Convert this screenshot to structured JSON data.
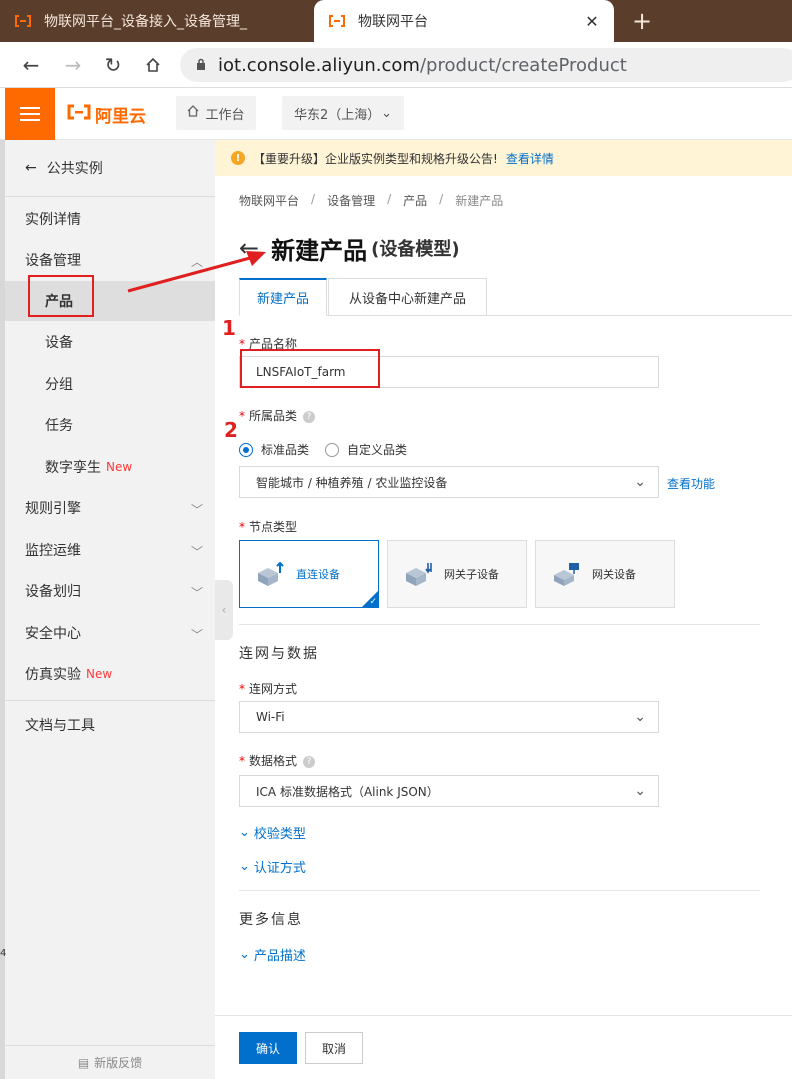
{
  "browser": {
    "tabs": [
      {
        "title": "物联网平台_设备接入_设备管理_",
        "active": false
      },
      {
        "title": "物联网平台",
        "active": true
      }
    ],
    "url_host": "iot.console.aliyun.com",
    "url_path": "/product/createProduct"
  },
  "header": {
    "logo_text": "阿里云",
    "workbench_label": "工作台",
    "region_label": "华东2（上海）"
  },
  "sidebar": {
    "back_label": "公共实例",
    "items": [
      {
        "label": "实例详情"
      },
      {
        "label": "设备管理"
      },
      {
        "label": "产品"
      },
      {
        "label": "设备"
      },
      {
        "label": "分组"
      },
      {
        "label": "任务"
      },
      {
        "label": "数字孪生",
        "tag": "New"
      },
      {
        "label": "规则引擎"
      },
      {
        "label": "监控运维"
      },
      {
        "label": "设备划归"
      },
      {
        "label": "安全中心"
      },
      {
        "label": "仿真实验",
        "tag": "New"
      },
      {
        "label": "文档与工具"
      }
    ],
    "feedback_label": "新版反馈"
  },
  "notice": {
    "text": "【重要升级】企业版实例类型和规格升级公告!",
    "link": "查看详情"
  },
  "breadcrumb": [
    "物联网平台",
    "设备管理",
    "产品",
    "新建产品"
  ],
  "page": {
    "title": "新建产品",
    "subtitle": "(设备模型)",
    "tabs": [
      "新建产品",
      "从设备中心新建产品"
    ]
  },
  "form": {
    "product_name_label": "产品名称",
    "product_name_value": "LNSFAIoT_farm",
    "category_label": "所属品类",
    "category_options": [
      "标准品类",
      "自定义品类"
    ],
    "category_value": "智能城市 / 种植养殖 / 农业监控设备",
    "view_features_link": "查看功能",
    "node_type_label": "节点类型",
    "node_types": [
      "直连设备",
      "网关子设备",
      "网关设备"
    ],
    "section_network": "连网与数据",
    "network_label": "连网方式",
    "network_value": "Wi-Fi",
    "data_format_label": "数据格式",
    "data_format_value": "ICA 标准数据格式（Alink JSON）",
    "expander_verify": "校验类型",
    "expander_auth": "认证方式",
    "section_more": "更多信息",
    "expander_desc": "产品描述"
  },
  "footer": {
    "confirm_label": "确认",
    "cancel_label": "取消"
  },
  "annotations": {
    "step1": "1",
    "step2": "2"
  },
  "colors": {
    "accent": "#0070cc",
    "brand": "#ff6a00",
    "annotation": "#e02020"
  }
}
